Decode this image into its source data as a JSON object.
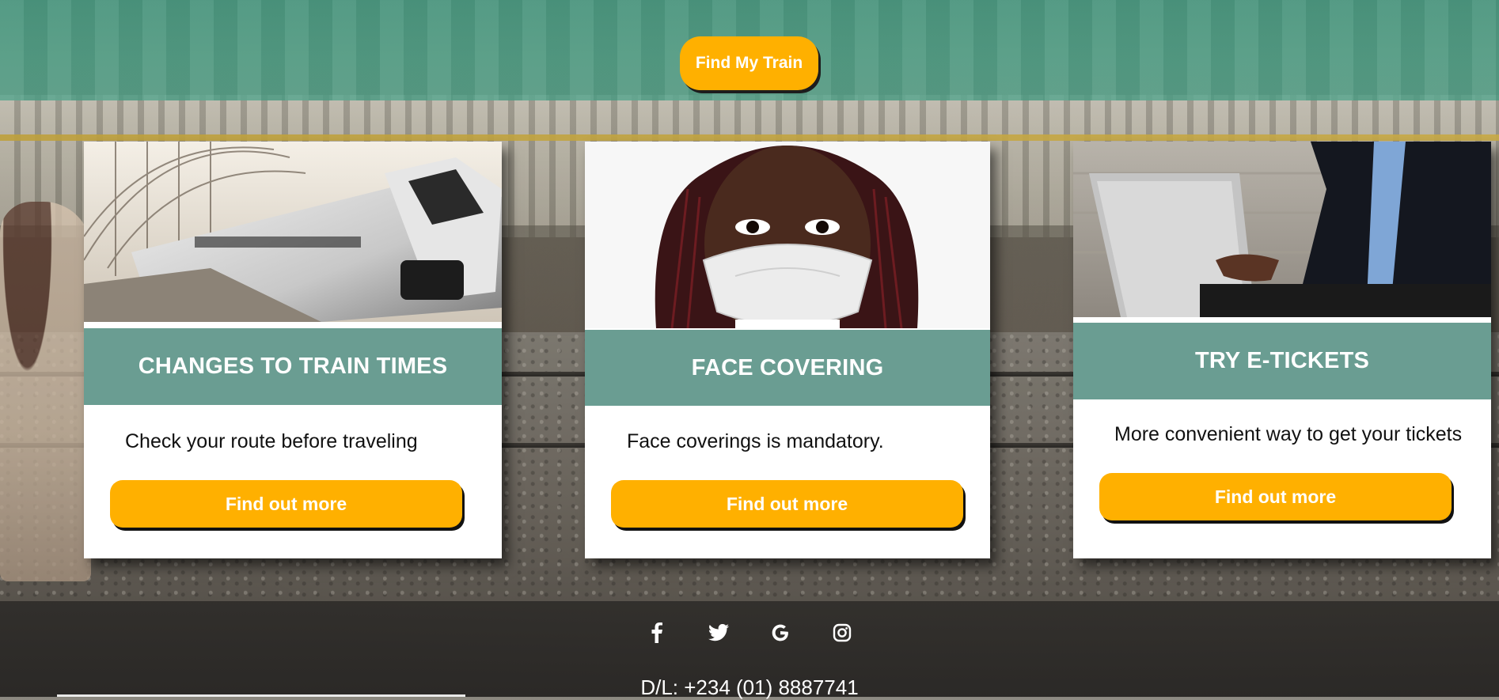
{
  "header": {
    "find_train_label": "Find My Train"
  },
  "cards": [
    {
      "title": "CHANGES TO TRAIN TIMES",
      "text": "Check your route before traveling",
      "button_label": "Find out more"
    },
    {
      "title": "FACE COVERING",
      "text": "Face coverings is mandatory.",
      "button_label": "Find out more"
    },
    {
      "title": "TRY E-TICKETS",
      "text": "More convenient way to get your tickets",
      "button_label": "Find out more"
    }
  ],
  "footer": {
    "social_icons": [
      "facebook-icon",
      "twitter-icon",
      "google-icon",
      "instagram-icon"
    ],
    "phone": "D/L: +234 (01) 8887741"
  },
  "colors": {
    "accent": "#ffb000",
    "band": "#6a9d92",
    "header": "#4c9e84",
    "footer": "#2e2c29"
  }
}
